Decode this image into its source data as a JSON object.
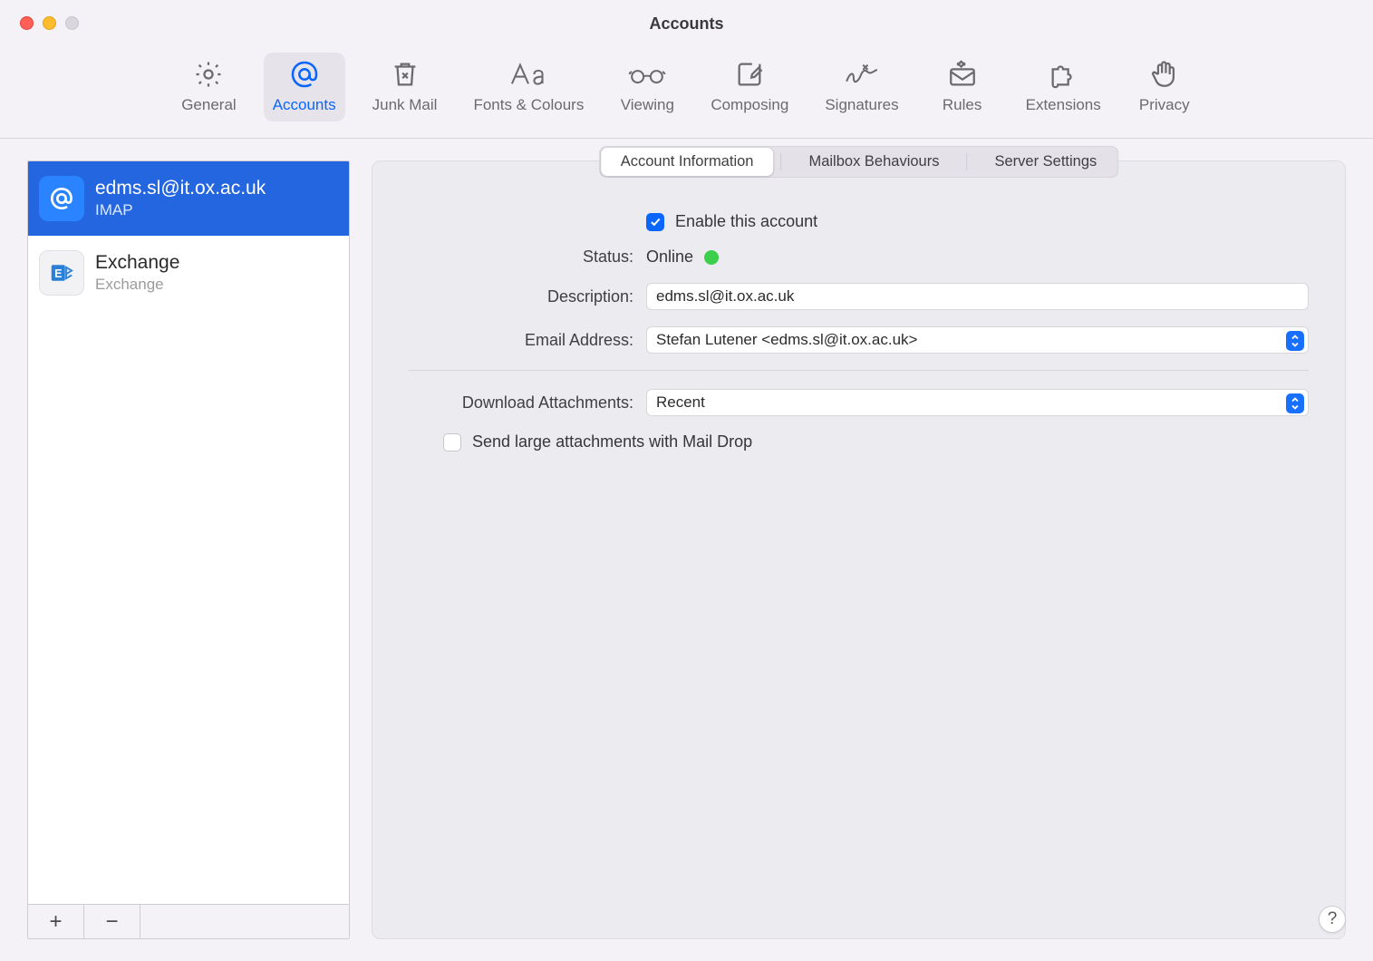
{
  "window": {
    "title": "Accounts"
  },
  "toolbar": {
    "items": [
      {
        "label": "General"
      },
      {
        "label": "Accounts"
      },
      {
        "label": "Junk Mail"
      },
      {
        "label": "Fonts & Colours"
      },
      {
        "label": "Viewing"
      },
      {
        "label": "Composing"
      },
      {
        "label": "Signatures"
      },
      {
        "label": "Rules"
      },
      {
        "label": "Extensions"
      },
      {
        "label": "Privacy"
      }
    ],
    "active_index": 1
  },
  "sidebar": {
    "accounts": [
      {
        "name": "edms.sl@it.ox.ac.uk",
        "subtitle": "IMAP",
        "type": "imap",
        "selected": true
      },
      {
        "name": "Exchange",
        "subtitle": "Exchange",
        "type": "exchange",
        "selected": false
      }
    ],
    "add_label": "+",
    "remove_label": "−"
  },
  "tabs": {
    "items": [
      {
        "label": "Account Information"
      },
      {
        "label": "Mailbox Behaviours"
      },
      {
        "label": "Server Settings"
      }
    ],
    "active_index": 0
  },
  "form": {
    "enable_label": "Enable this account",
    "enable_checked": true,
    "status_label": "Status:",
    "status_value": "Online",
    "description_label": "Description:",
    "description_value": "edms.sl@it.ox.ac.uk",
    "email_label": "Email Address:",
    "email_value": "Stefan Lutener <edms.sl@it.ox.ac.uk>",
    "download_label": "Download Attachments:",
    "download_value": "Recent",
    "maildrop_label": "Send large attachments with Mail Drop",
    "maildrop_checked": false
  },
  "help": {
    "label": "?"
  }
}
